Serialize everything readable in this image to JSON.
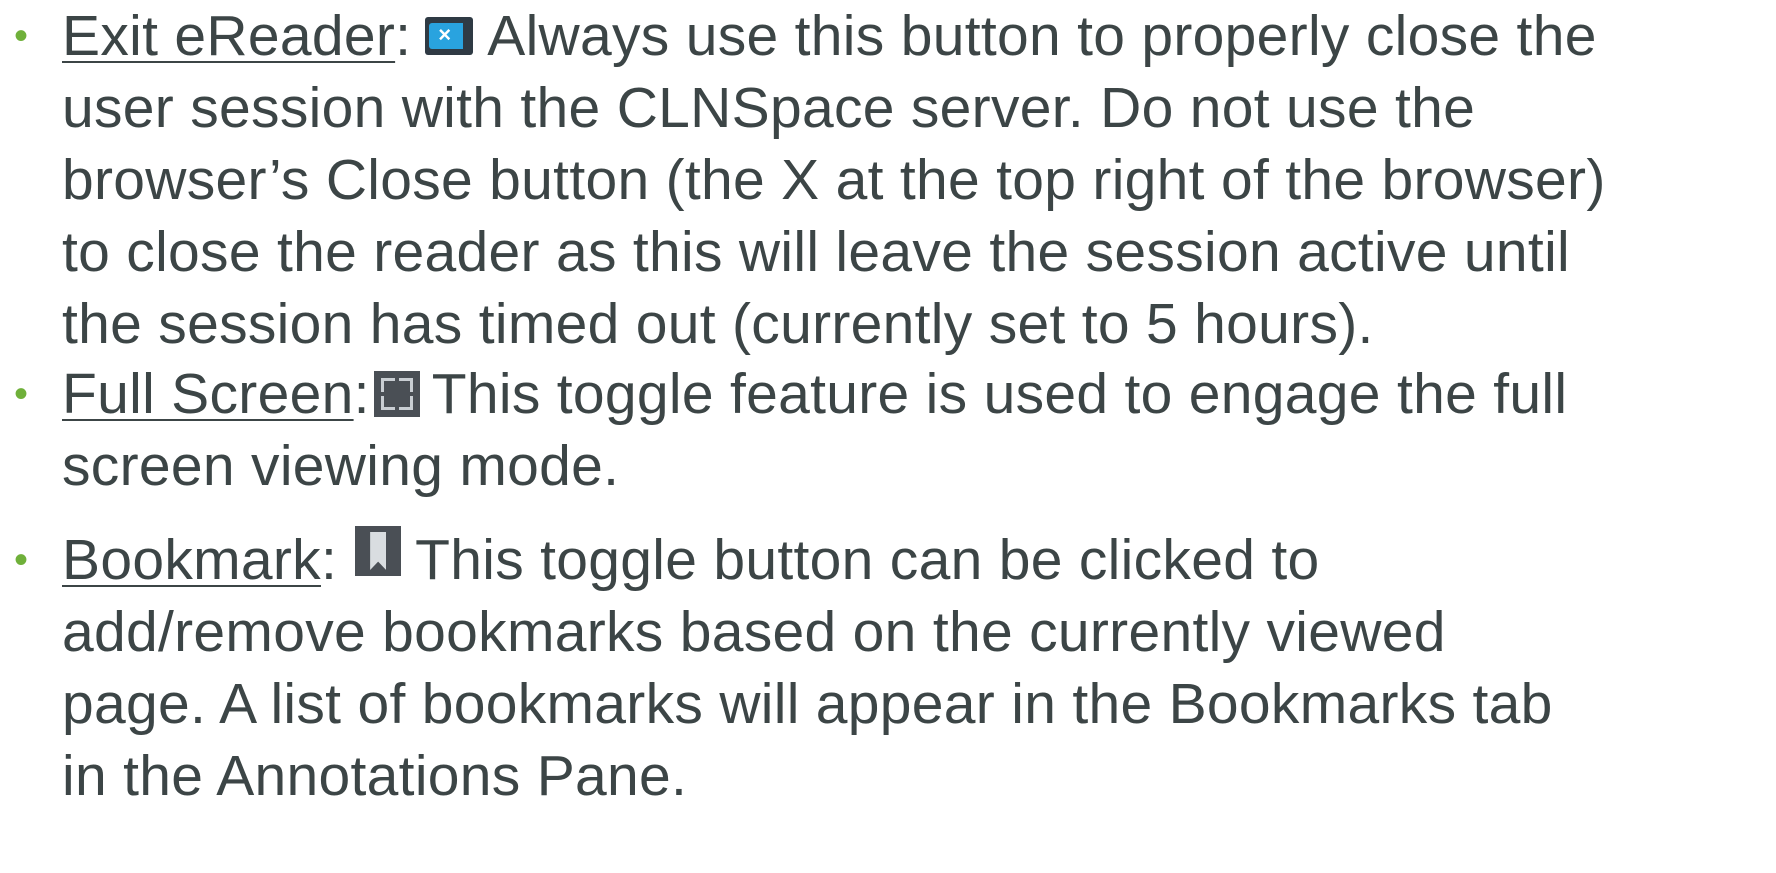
{
  "items": [
    {
      "term": "Exit eReader",
      "sep": ":",
      "icon": "exit-ereader-icon",
      "lines": [
        "Always use this button to properly close the",
        "user session with the CLNSpace server.  Do not use the",
        "browser’s Close button (the X at the top right of the browser)",
        "to close the reader as this will leave the session active until",
        "the session has timed out (currently set to 5 hours)."
      ]
    },
    {
      "term": "Full Screen",
      "sep": ":",
      "icon": "full-screen-icon",
      "lines": [
        "This toggle feature is used to engage the full",
        "screen viewing mode."
      ]
    },
    {
      "term": "Bookmark",
      "sep": ":",
      "icon": "bookmark-icon",
      "lines": [
        "This toggle button can be clicked to",
        "add/remove bookmarks based on the currently viewed",
        "page.  A list of bookmarks will appear in the Bookmarks tab",
        "in the Annotations Pane."
      ]
    }
  ],
  "bullet_char": "•",
  "colors": {
    "text": "#3c4546",
    "bullet": "#6fb03a",
    "exit_icon": "#29a3df"
  }
}
